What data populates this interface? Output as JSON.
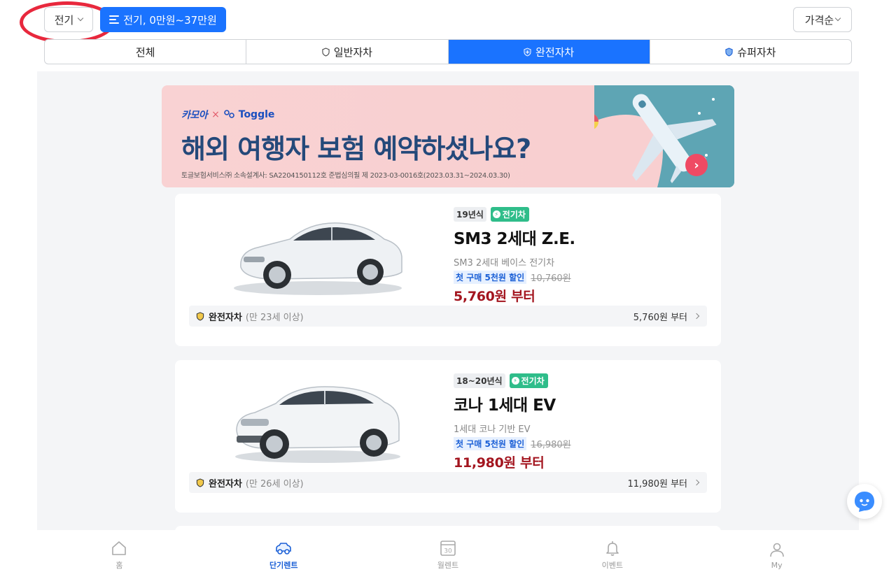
{
  "filters": {
    "fuel_label": "전기",
    "summary_label": "전기, 0만원~37만원",
    "sort_label": "가격순"
  },
  "tabs": [
    {
      "label": "전체",
      "icon": null,
      "active": false
    },
    {
      "label": "일반자차",
      "icon": "shield-outline-icon",
      "active": false
    },
    {
      "label": "완전자차",
      "icon": "shield-plus-icon",
      "active": true
    },
    {
      "label": "슈퍼자차",
      "icon": "shield-blue-icon",
      "active": false
    }
  ],
  "banner": {
    "brand_kamo": "카모아",
    "brand_x": "×",
    "brand_toggle": "Toggle",
    "title": "해외 여행자 보험 예약하셨나요?",
    "legal": "토글보험서비스㈜ 소속설계사: SA2204150112호 준법심의필 제 2023-03-0016호(2023.03.31~2024.03.30)",
    "arrow": "›",
    "colors": {
      "bg": "#f8cfd0",
      "accent": "#5ea5b4",
      "title": "#24497a"
    }
  },
  "cars": [
    {
      "year_tag": "19년식",
      "ev_tag": "전기차",
      "name": "SM3 2세대 Z.E.",
      "sub": "SM3 2세대 베이스 전기차",
      "discount_badge": "첫 구매 5천원 할인",
      "old_price": "10,760원",
      "price": "5,760원 부터",
      "option_type": "완전자차",
      "option_age": "(만 23세 이상)",
      "option_price": "5,760원 부터"
    },
    {
      "year_tag": "18~20년식",
      "ev_tag": "전기차",
      "name": "코나 1세대 EV",
      "sub": "1세대 코나 기반 EV",
      "discount_badge": "첫 구매 5천원 할인",
      "old_price": "16,980원",
      "price": "11,980원 부터",
      "option_type": "완전자차",
      "option_age": "(만 26세 이상)",
      "option_price": "11,980원 부터"
    }
  ],
  "bottom_nav": [
    {
      "label": "홈",
      "icon": "home-icon",
      "active": false
    },
    {
      "label": "단기렌트",
      "icon": "car-icon",
      "active": true
    },
    {
      "label": "월렌트",
      "icon": "calendar-icon",
      "active": false,
      "icon_text": "30"
    },
    {
      "label": "이벤트",
      "icon": "bell-icon",
      "active": false
    },
    {
      "label": "My",
      "icon": "person-icon",
      "active": false
    }
  ],
  "colors": {
    "primary": "#1a73ff",
    "price": "#a3151f",
    "ev_green": "#2fbd8a",
    "highlight_circle": "#e8283d"
  }
}
